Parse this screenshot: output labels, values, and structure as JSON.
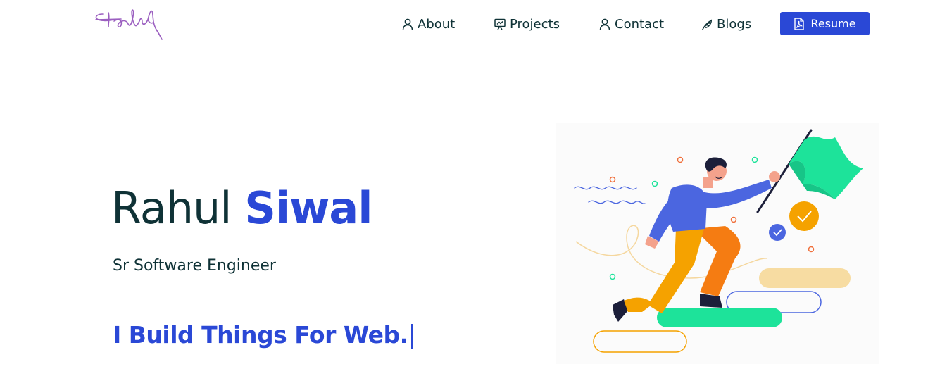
{
  "header": {
    "logo_text": "Rahul",
    "nav": {
      "about": "About",
      "projects": "Projects",
      "contact": "Contact",
      "blogs": "Blogs",
      "resume": "Resume"
    }
  },
  "hero": {
    "first_name": "Rahul",
    "last_name": "Siwal",
    "role": "Sr Software Engineer",
    "tagline": "I Build Things For Web."
  },
  "colors": {
    "accent": "#2a48d6",
    "text": "#0f3236",
    "logo": "#9b5fc0",
    "illustration_green": "#1de39a",
    "illustration_orange": "#f5a200"
  },
  "icons": {
    "about": "user-icon",
    "projects": "presentation-icon",
    "contact": "user-icon",
    "blogs": "feather-icon",
    "resume": "pdf-file-icon"
  }
}
